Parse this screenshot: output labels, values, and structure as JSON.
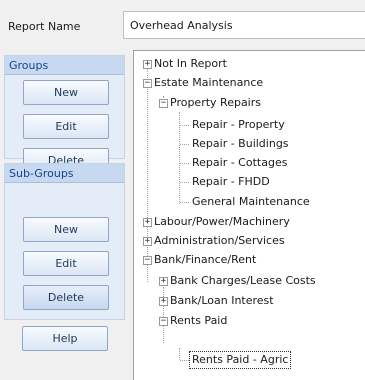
{
  "report_name": {
    "label": "Report Name",
    "value": "Overhead Analysis"
  },
  "groups": {
    "title": "Groups",
    "new": "New",
    "edit": "Edit",
    "delete": "Delete"
  },
  "subgroups": {
    "title": "Sub-Groups",
    "new": "New",
    "edit": "Edit",
    "delete": "Delete"
  },
  "help": "Help",
  "tree": [
    {
      "label": "Not In Report",
      "toggle": "+"
    },
    {
      "label": "Estate Maintenance",
      "toggle": "−"
    },
    {
      "label": "Property Repairs",
      "toggle": "−"
    },
    {
      "label": "Repair - Property"
    },
    {
      "label": "Repair - Buildings"
    },
    {
      "label": "Repair - Cottages"
    },
    {
      "label": "Repair - FHDD"
    },
    {
      "label": "General Maintenance"
    },
    {
      "label": "Labour/Power/Machinery",
      "toggle": "+"
    },
    {
      "label": "Administration/Services",
      "toggle": "+"
    },
    {
      "label": "Bank/Finance/Rent",
      "toggle": "−"
    },
    {
      "label": "Bank Charges/Lease Costs",
      "toggle": "+"
    },
    {
      "label": "Bank/Loan Interest",
      "toggle": "+"
    },
    {
      "label": "Rents Paid",
      "toggle": "−"
    },
    {
      "label": "Rents Paid - Agric",
      "selected": "true"
    }
  ]
}
